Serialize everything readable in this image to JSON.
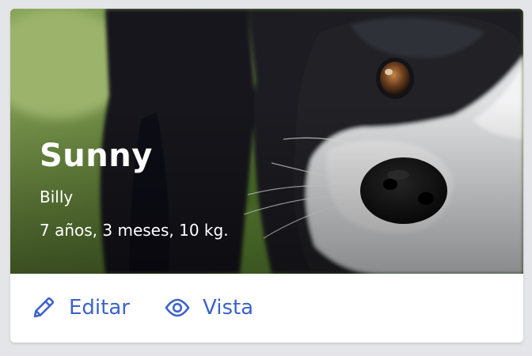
{
  "pet_card": {
    "name": "Sunny",
    "owner": "Billy",
    "details": "7 años, 3 meses, 10 kg.",
    "photo": "dog-photo",
    "actions": {
      "edit_label": "Editar",
      "edit_icon": "pencil-icon",
      "view_label": "Vista",
      "view_icon": "eye-icon"
    }
  },
  "colors": {
    "accent": "#3d63c9",
    "text_on_photo": "#ffffff",
    "page_background": "#e4e5e8",
    "card_background": "#ffffff"
  }
}
